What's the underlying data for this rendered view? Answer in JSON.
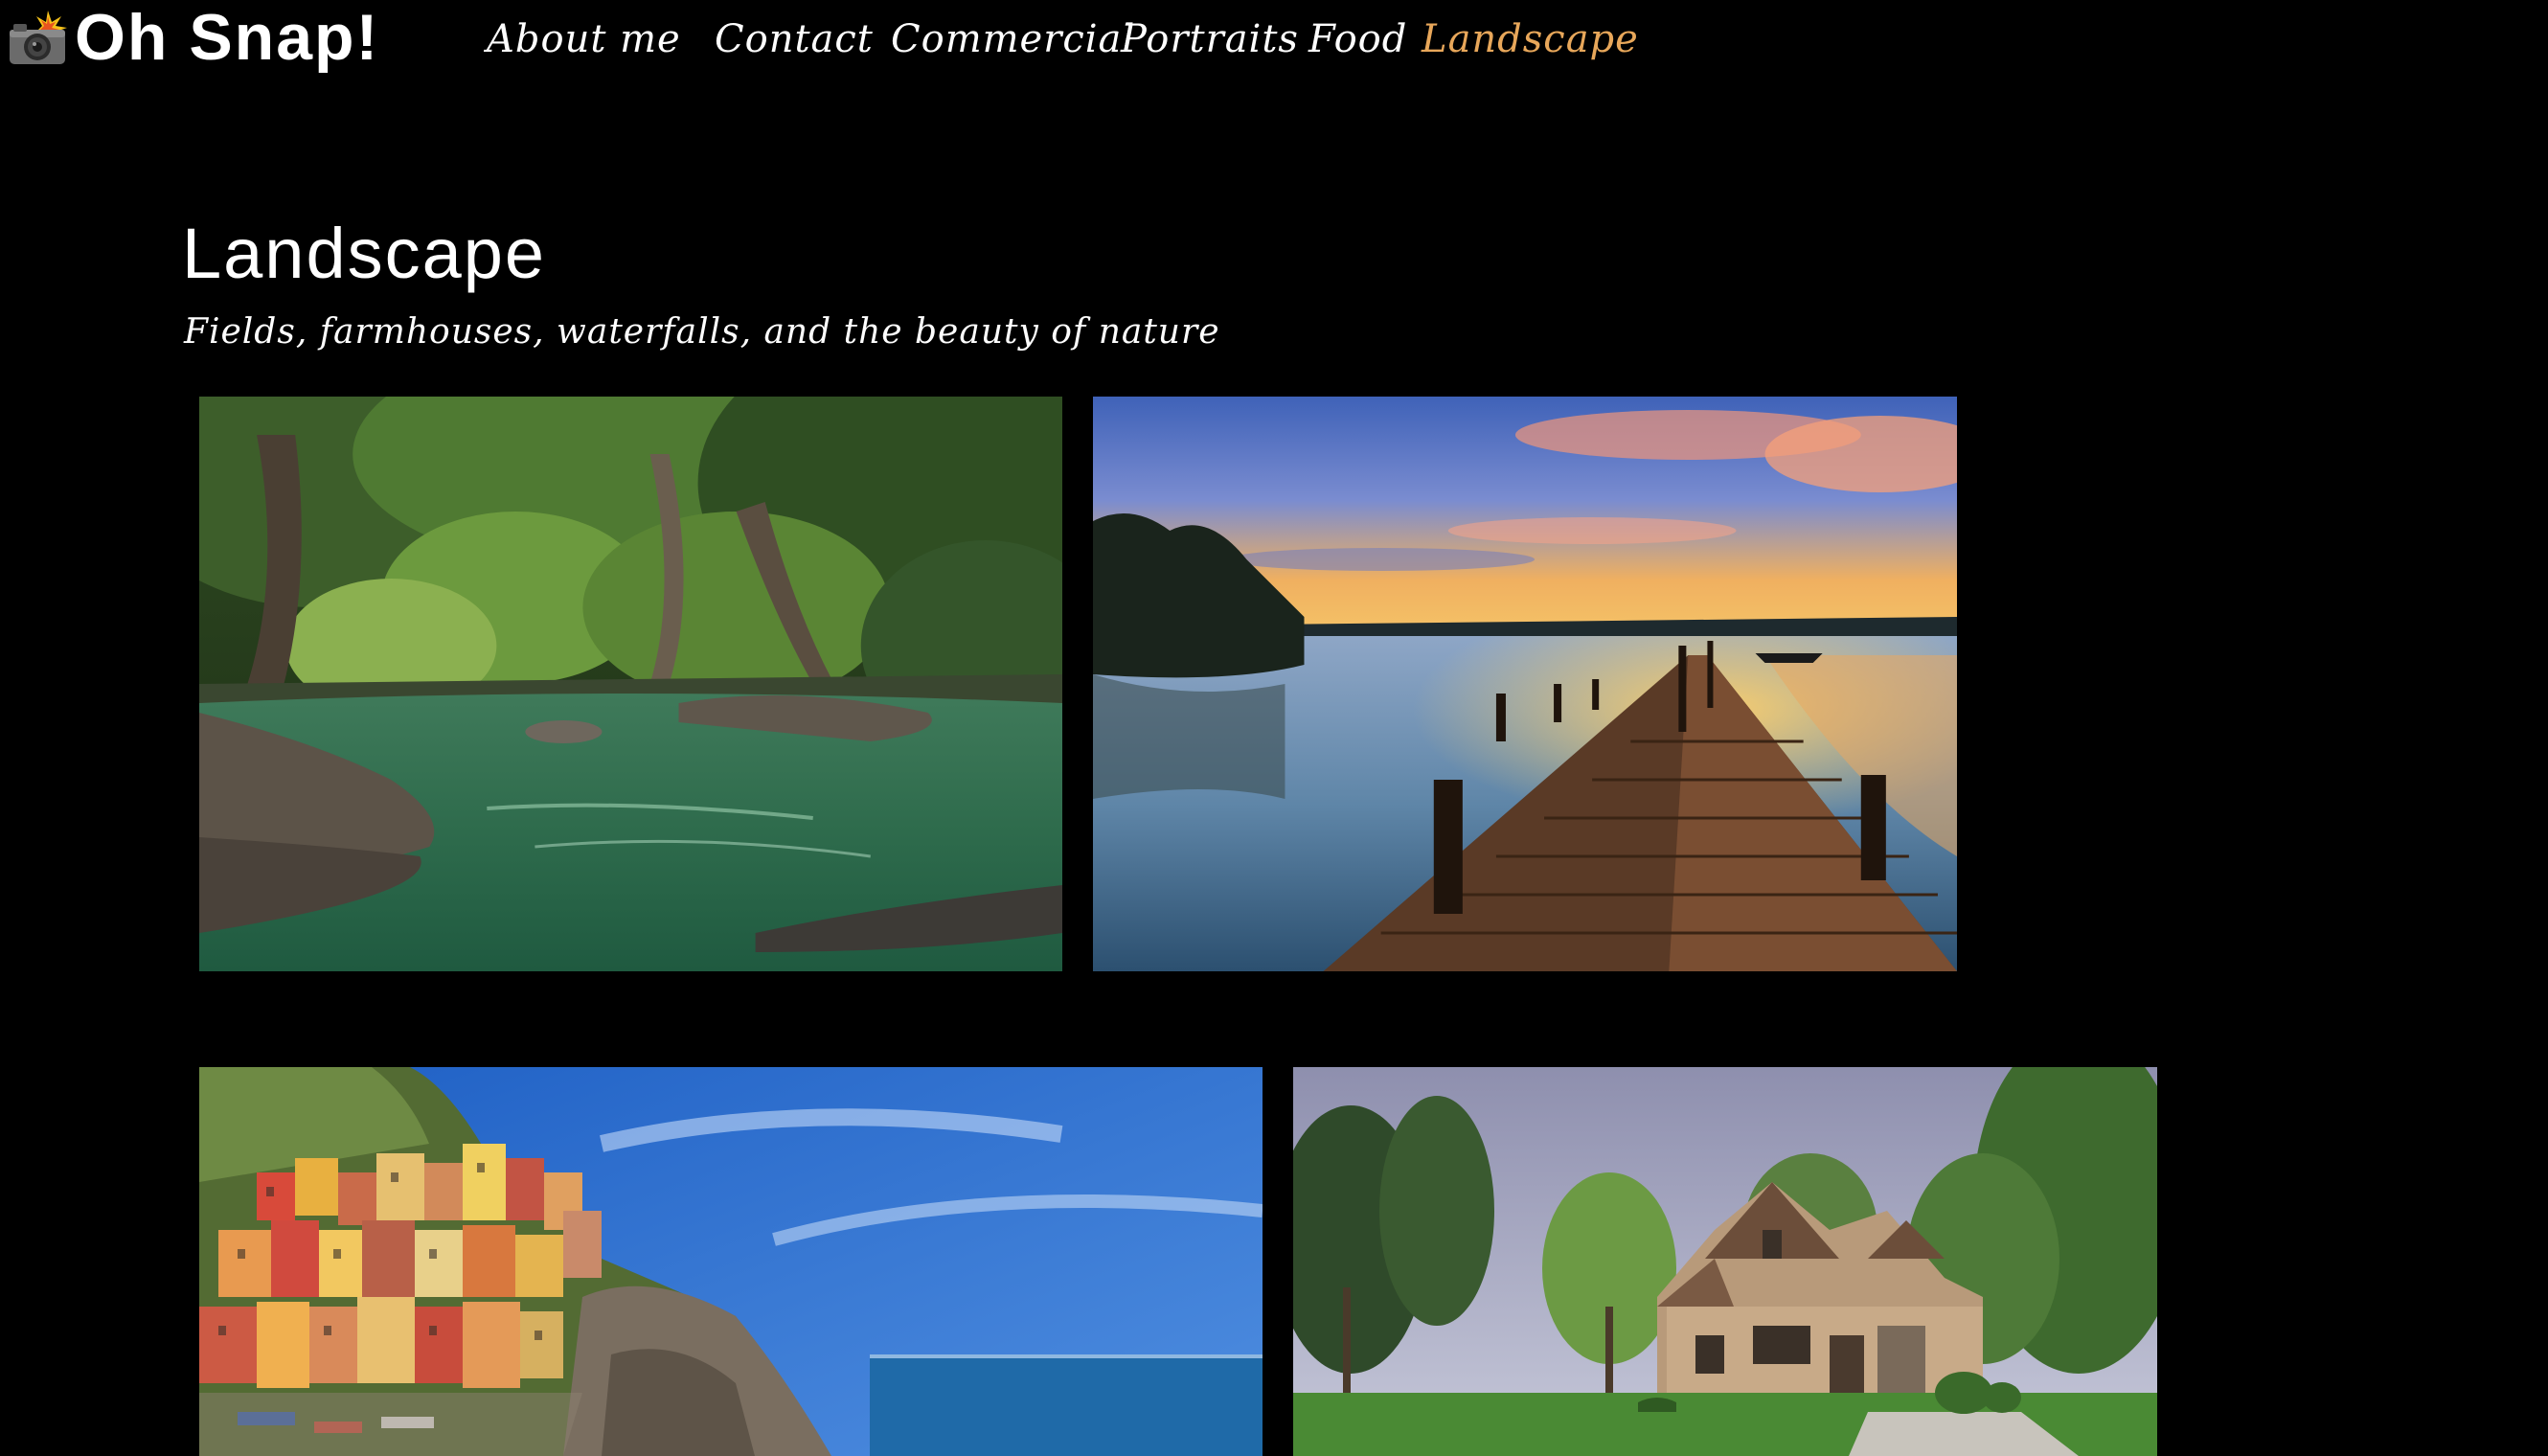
{
  "header": {
    "logo_text": "Oh Snap!",
    "logo_icon": "camera-flash-icon"
  },
  "nav": {
    "items": [
      {
        "label": "About me",
        "active": false
      },
      {
        "label": "Contact",
        "active": false
      },
      {
        "label": "Commercial",
        "active": false
      },
      {
        "label": "Portraits",
        "active": false
      },
      {
        "label": "Food",
        "active": false
      },
      {
        "label": "Landscape",
        "active": true
      }
    ],
    "active_color": "#e8a75a",
    "text_color": "#ffffff"
  },
  "main": {
    "title": "Landscape",
    "subtitle": "Fields, farmhouses, waterfalls, and the beauty of nature"
  },
  "gallery": {
    "photos": [
      {
        "subject": "forest river"
      },
      {
        "subject": "wooden pier at sunset lake"
      },
      {
        "subject": "colorful cliffside village by the sea"
      },
      {
        "subject": "stone house with lawn and trees"
      }
    ]
  },
  "colors": {
    "background": "#000000",
    "accent": "#e8a75a"
  }
}
